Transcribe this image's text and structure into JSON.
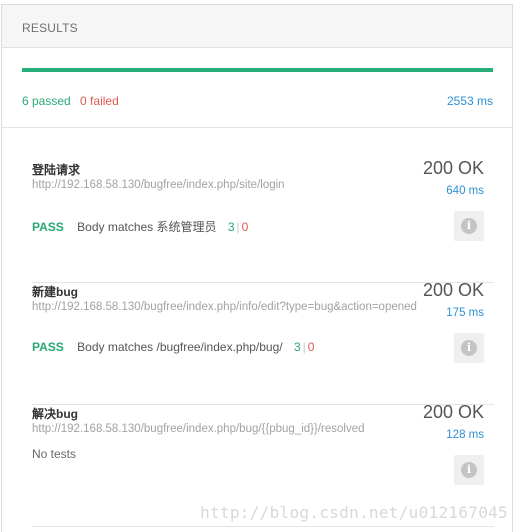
{
  "header": {
    "title": "RESULTS"
  },
  "summary": {
    "progress_fraction": 1.0,
    "progress_color": "#27ae7a",
    "passed_text": "6 passed",
    "failed_text": "0 failed",
    "total_time": "2553 ms"
  },
  "requests": [
    {
      "name": "登陆请求",
      "url": "http://192.168.58.130/bugfree/index.php/site/login",
      "status": "200 OK",
      "time": "640 ms",
      "test": {
        "result": "PASS",
        "description": "Body matches 系统管理员",
        "passed": "3",
        "separator": "|",
        "failed": "0"
      }
    },
    {
      "name": "新建bug",
      "url": "http://192.168.58.130/bugfree/index.php/info/edit?type=bug&action=opened",
      "status": "200 OK",
      "time": "175 ms",
      "test": {
        "result": "PASS",
        "description": "Body matches /bugfree/index.php/bug/",
        "passed": "3",
        "separator": "|",
        "failed": "0"
      }
    },
    {
      "name": "解决bug",
      "url": "http://192.168.58.130/bugfree/index.php/bug/{{pbug_id}}/resolved",
      "status": "200 OK",
      "time": "128 ms",
      "no_tests": "No tests"
    }
  ],
  "icons": {
    "info": "info-icon"
  },
  "watermark": "http://blog.csdn.net/u012167045"
}
